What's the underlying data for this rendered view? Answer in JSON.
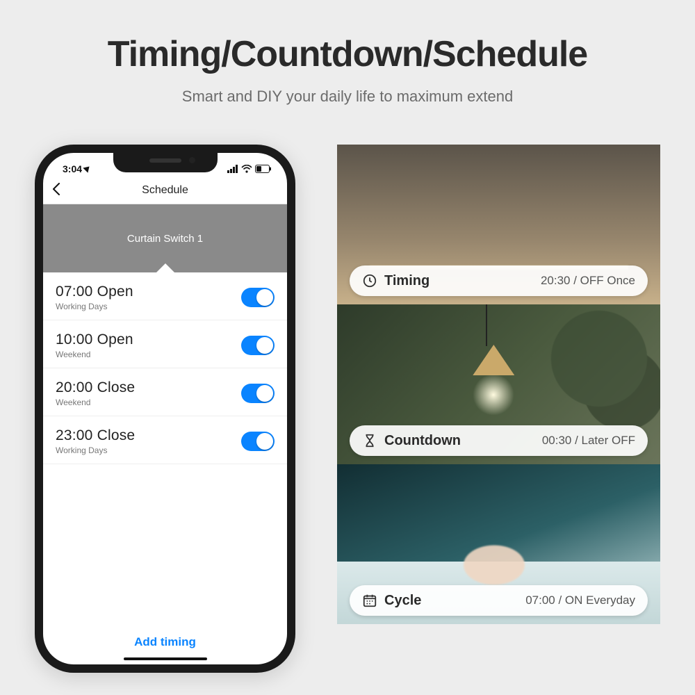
{
  "headline": "Timing/Countdown/Schedule",
  "subhead": "Smart and DIY your daily life to maximum extend",
  "status": {
    "time": "3:04"
  },
  "nav": {
    "title": "Schedule"
  },
  "device": {
    "name": "Curtain Switch 1"
  },
  "schedule": [
    {
      "time": "07:00",
      "action": "Open",
      "days": "Working Days",
      "on": true
    },
    {
      "time": "10:00",
      "action": "Open",
      "days": "Weekend",
      "on": true
    },
    {
      "time": "20:00",
      "action": "Close",
      "days": "Weekend",
      "on": true
    },
    {
      "time": "23:00",
      "action": "Close",
      "days": "Working Days",
      "on": true
    }
  ],
  "add_timing_label": "Add timing",
  "pills": {
    "timing": {
      "label": "Timing",
      "value": "20:30 / OFF Once"
    },
    "countdown": {
      "label": "Countdown",
      "value": "00:30 / Later OFF"
    },
    "cycle": {
      "label": "Cycle",
      "value": "07:00 / ON Everyday"
    }
  }
}
